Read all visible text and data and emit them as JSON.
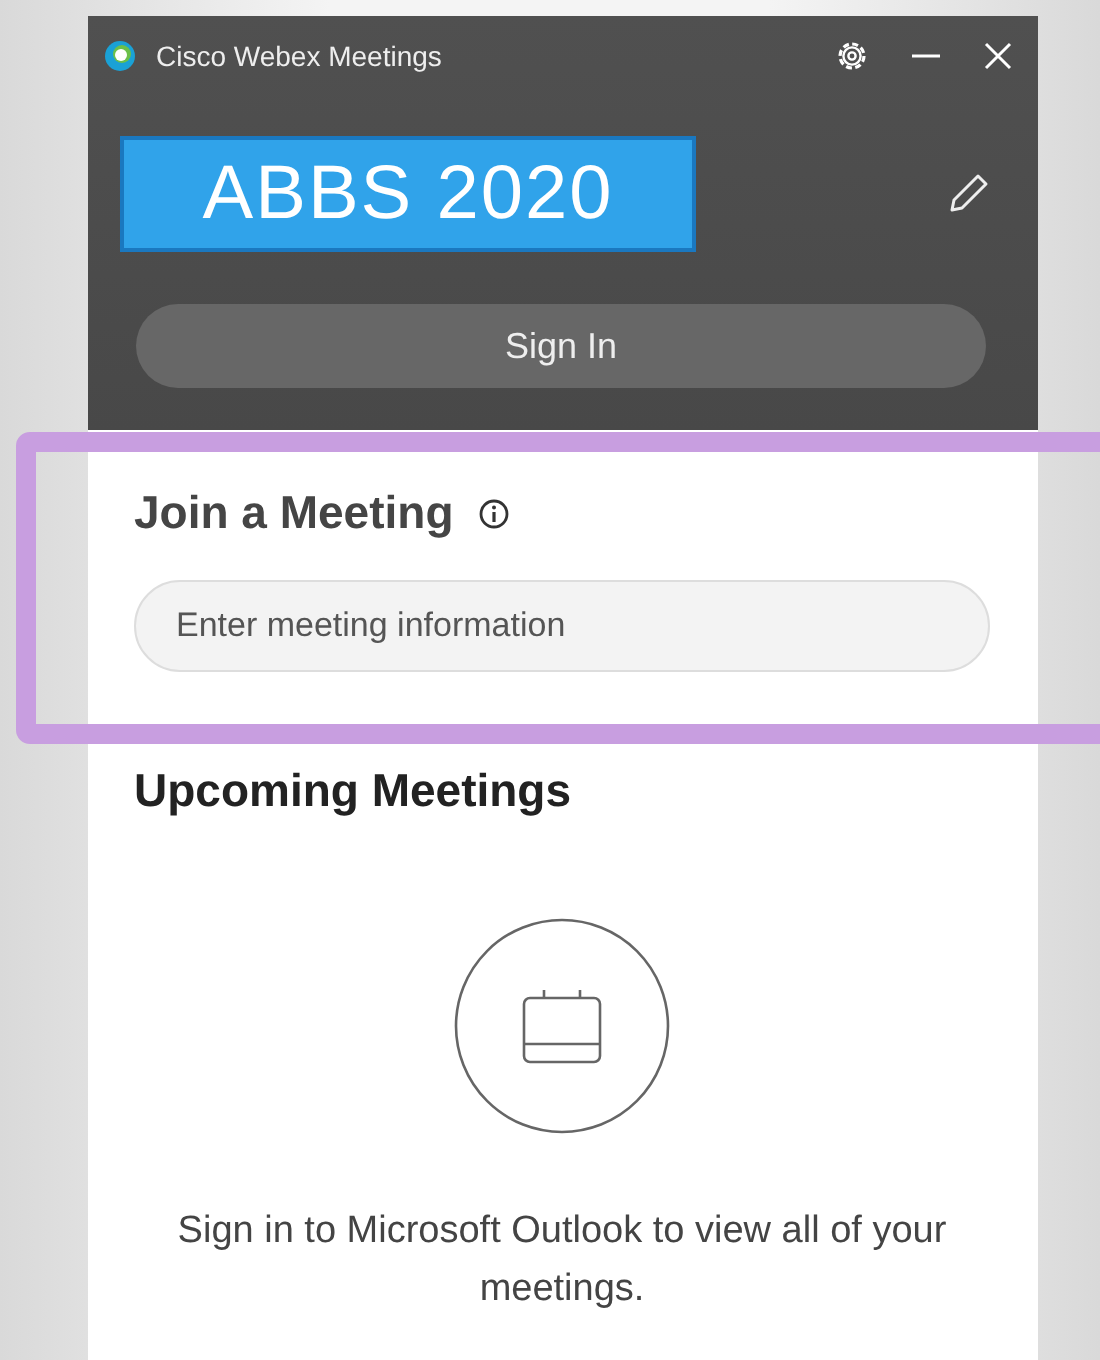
{
  "window": {
    "title": "Cisco Webex Meetings"
  },
  "banner": {
    "text": "ABBS 2020"
  },
  "sign_in_button": "Sign In",
  "join": {
    "title": "Join a Meeting",
    "field": {
      "placeholder": "Enter meeting information"
    }
  },
  "upcoming": {
    "title": "Upcoming Meetings",
    "message": "Sign in to Microsoft Outlook to view all of your meetings."
  }
}
